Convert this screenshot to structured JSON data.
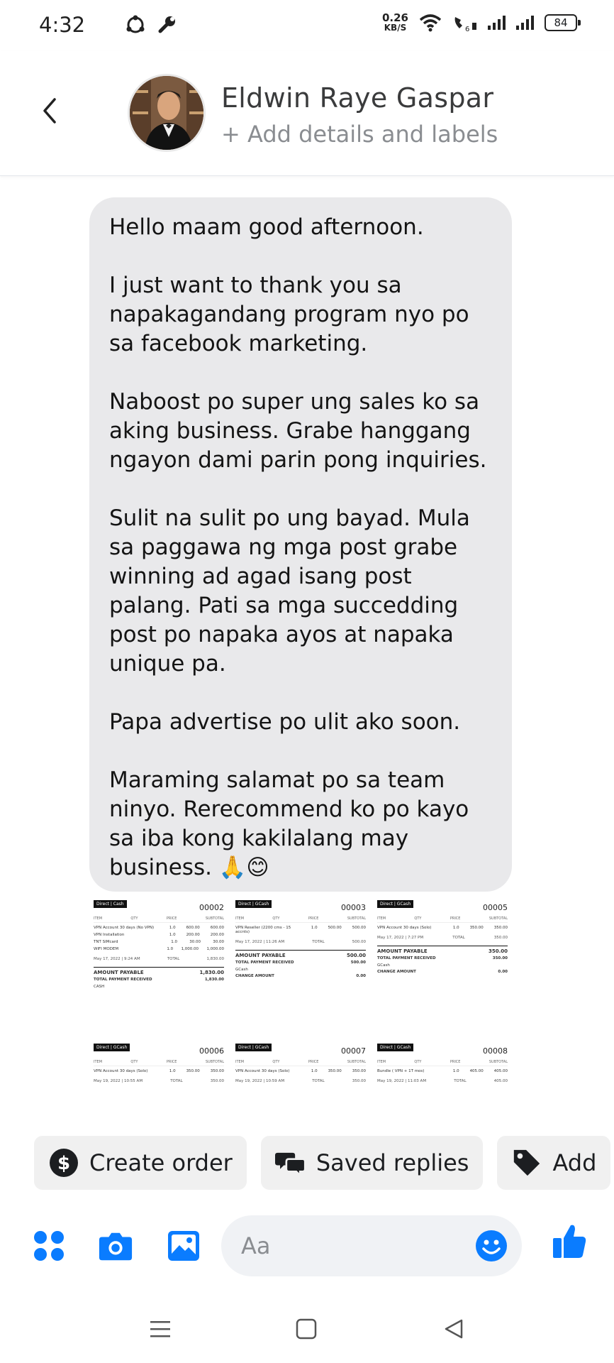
{
  "status_bar": {
    "time": "4:32",
    "net_speed_value": "0.26",
    "net_speed_unit": "KB/S",
    "battery": "84"
  },
  "header": {
    "contact_name": "Eldwin Raye Gaspar",
    "subtitle": "+ Add details and labels"
  },
  "message": {
    "paragraphs": [
      "Hello maam good afternoon.",
      "I just want to thank you sa napakagandang program nyo po sa facebook marketing.",
      "Naboost po super ung sales ko sa aking business. Grabe hanggang ngayon dami parin pong inquiries.",
      "Sulit na sulit po ung bayad. Mula sa paggawa ng mga post grabe winning ad agad isang post palang. Pati sa mga succedding post po napaka ayos at napaka unique pa.",
      "Papa advertise po ulit ako soon.",
      "Maraming salamat po sa team ninyo. Rerecommend ko po kayo sa iba kong kakilalang may business. 🙏😊"
    ]
  },
  "receipts": [
    {
      "tag": "Direct | Cash",
      "number": "00002",
      "headers": [
        "ITEM",
        "QTY",
        "PRICE",
        "SUBTOTAL"
      ],
      "items": [
        {
          "name": "VPN Account 30 days (No VPN)",
          "qty": "1.0",
          "price": "600.00",
          "subtotal": "600.00"
        },
        {
          "name": "VPN Installation",
          "qty": "1.0",
          "price": "200.00",
          "subtotal": "200.00"
        },
        {
          "name": "TNT SIMcard",
          "qty": "1.0",
          "price": "30.00",
          "subtotal": "30.00"
        },
        {
          "name": "WIFI MODEM",
          "qty": "1.0",
          "price": "1,000.00",
          "subtotal": "1,000.00"
        }
      ],
      "date": "May 17, 2022 | 9:24 AM",
      "total_label": "TOTAL",
      "total": "1,830.00",
      "amount_payable_label": "AMOUNT PAYABLE",
      "amount_payable": "1,830.00",
      "payment_label": "TOTAL PAYMENT RECEIVED",
      "payment": "1,830.00",
      "method": "CASH"
    },
    {
      "tag": "Direct | GCash",
      "number": "00003",
      "headers": [
        "ITEM",
        "QTY",
        "PRICE",
        "SUBTOTAL"
      ],
      "items": [
        {
          "name": "VPN Reseller (2200 cms - 15 accnts)",
          "qty": "1.0",
          "price": "500.00",
          "subtotal": "500.00"
        }
      ],
      "date": "May 17, 2022 | 11:26 AM",
      "total_label": "TOTAL",
      "total": "500.00",
      "amount_payable_label": "AMOUNT PAYABLE",
      "amount_payable": "500.00",
      "payment_label": "TOTAL PAYMENT RECEIVED",
      "payment": "500.00",
      "method": "GCash",
      "change_label": "CHANGE AMOUNT",
      "change": "0.00"
    },
    {
      "tag": "Direct | GCash",
      "number": "00005",
      "headers": [
        "ITEM",
        "QTY",
        "PRICE",
        "SUBTOTAL"
      ],
      "items": [
        {
          "name": "VPN Account 30 days (Solo)",
          "qty": "1.0",
          "price": "350.00",
          "subtotal": "350.00"
        }
      ],
      "date": "May 17, 2022 | 7:27 PM",
      "total_label": "TOTAL",
      "total": "350.00",
      "amount_payable_label": "AMOUNT PAYABLE",
      "amount_payable": "350.00",
      "payment_label": "TOTAL PAYMENT RECEIVED",
      "payment": "350.00",
      "method": "GCash",
      "change_label": "CHANGE AMOUNT",
      "change": "0.00"
    },
    {
      "tag": "Direct | GCash",
      "number": "00006",
      "headers": [
        "ITEM",
        "QTY",
        "PRICE",
        "SUBTOTAL"
      ],
      "items": [
        {
          "name": "VPN Account 30 days (Solo)",
          "qty": "1.0",
          "price": "350.00",
          "subtotal": "350.00"
        }
      ],
      "date": "May 19, 2022 | 10:55 AM",
      "total_label": "TOTAL",
      "total": "350.00"
    },
    {
      "tag": "Direct | GCash",
      "number": "00007",
      "headers": [
        "ITEM",
        "QTY",
        "PRICE",
        "SUBTOTAL"
      ],
      "items": [
        {
          "name": "VPN Account 30 days (Solo)",
          "qty": "1.0",
          "price": "350.00",
          "subtotal": "350.00"
        }
      ],
      "date": "May 19, 2022 | 10:59 AM",
      "total_label": "TOTAL",
      "total": "350.00"
    },
    {
      "tag": "Direct | GCash",
      "number": "00008",
      "headers": [
        "ITEM",
        "QTY",
        "PRICE",
        "SUBTOTAL"
      ],
      "items": [
        {
          "name": "Bundle ( VPN + 1T mos)",
          "qty": "1.0",
          "price": "405.00",
          "subtotal": "405.00"
        }
      ],
      "date": "May 19, 2022 | 11:03 AM",
      "total_label": "TOTAL",
      "total": "405.00"
    }
  ],
  "quick_actions": [
    {
      "label": "Create order",
      "icon": "dollar-circle-icon"
    },
    {
      "label": "Saved replies",
      "icon": "chat-bubbles-icon"
    },
    {
      "label": "Add",
      "icon": "tag-icon"
    }
  ],
  "composer": {
    "placeholder": "Aa"
  },
  "colors": {
    "accent": "#0a7cff",
    "bubble": "#e9e9eb",
    "chip": "#f0f0f0"
  }
}
